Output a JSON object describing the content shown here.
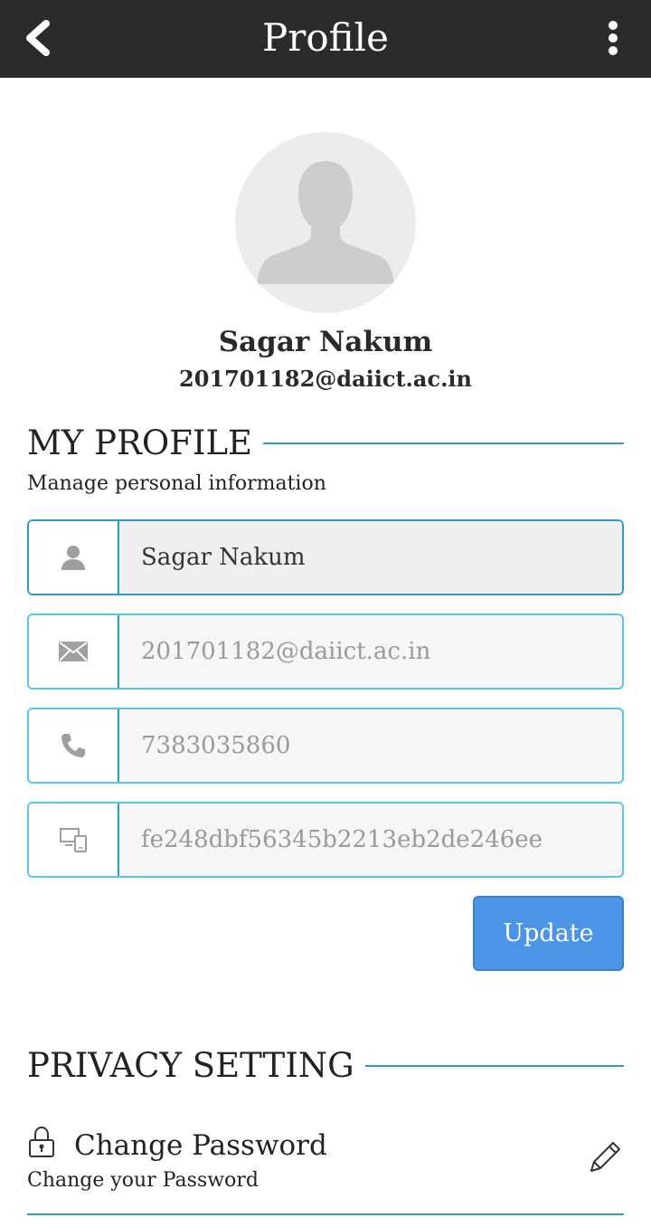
{
  "header": {
    "title": "Profile",
    "back_icon": "chevron-left-icon",
    "menu_icon": "more-vertical-icon"
  },
  "user": {
    "name": "Sagar Nakum",
    "email": "201701182@daiict.ac.in"
  },
  "my_profile": {
    "title": "MY PROFILE",
    "subtitle": "Manage personal information",
    "fields": {
      "name": {
        "icon": "user-icon",
        "value": "Sagar Nakum"
      },
      "email": {
        "icon": "mail-icon",
        "value": "201701182@daiict.ac.in"
      },
      "phone": {
        "icon": "phone-icon",
        "value": "7383035860"
      },
      "device": {
        "icon": "devices-icon",
        "value": "fe248dbf56345b2213eb2de246ee"
      }
    },
    "update_label": "Update"
  },
  "privacy": {
    "title": "PRIVACY SETTING",
    "change_password_label": "Change Password",
    "change_password_sub": "Change your Password"
  },
  "colors": {
    "topbar": "#2b2b2b",
    "accent": "#2d9cc4",
    "button": "#4c95e6"
  }
}
